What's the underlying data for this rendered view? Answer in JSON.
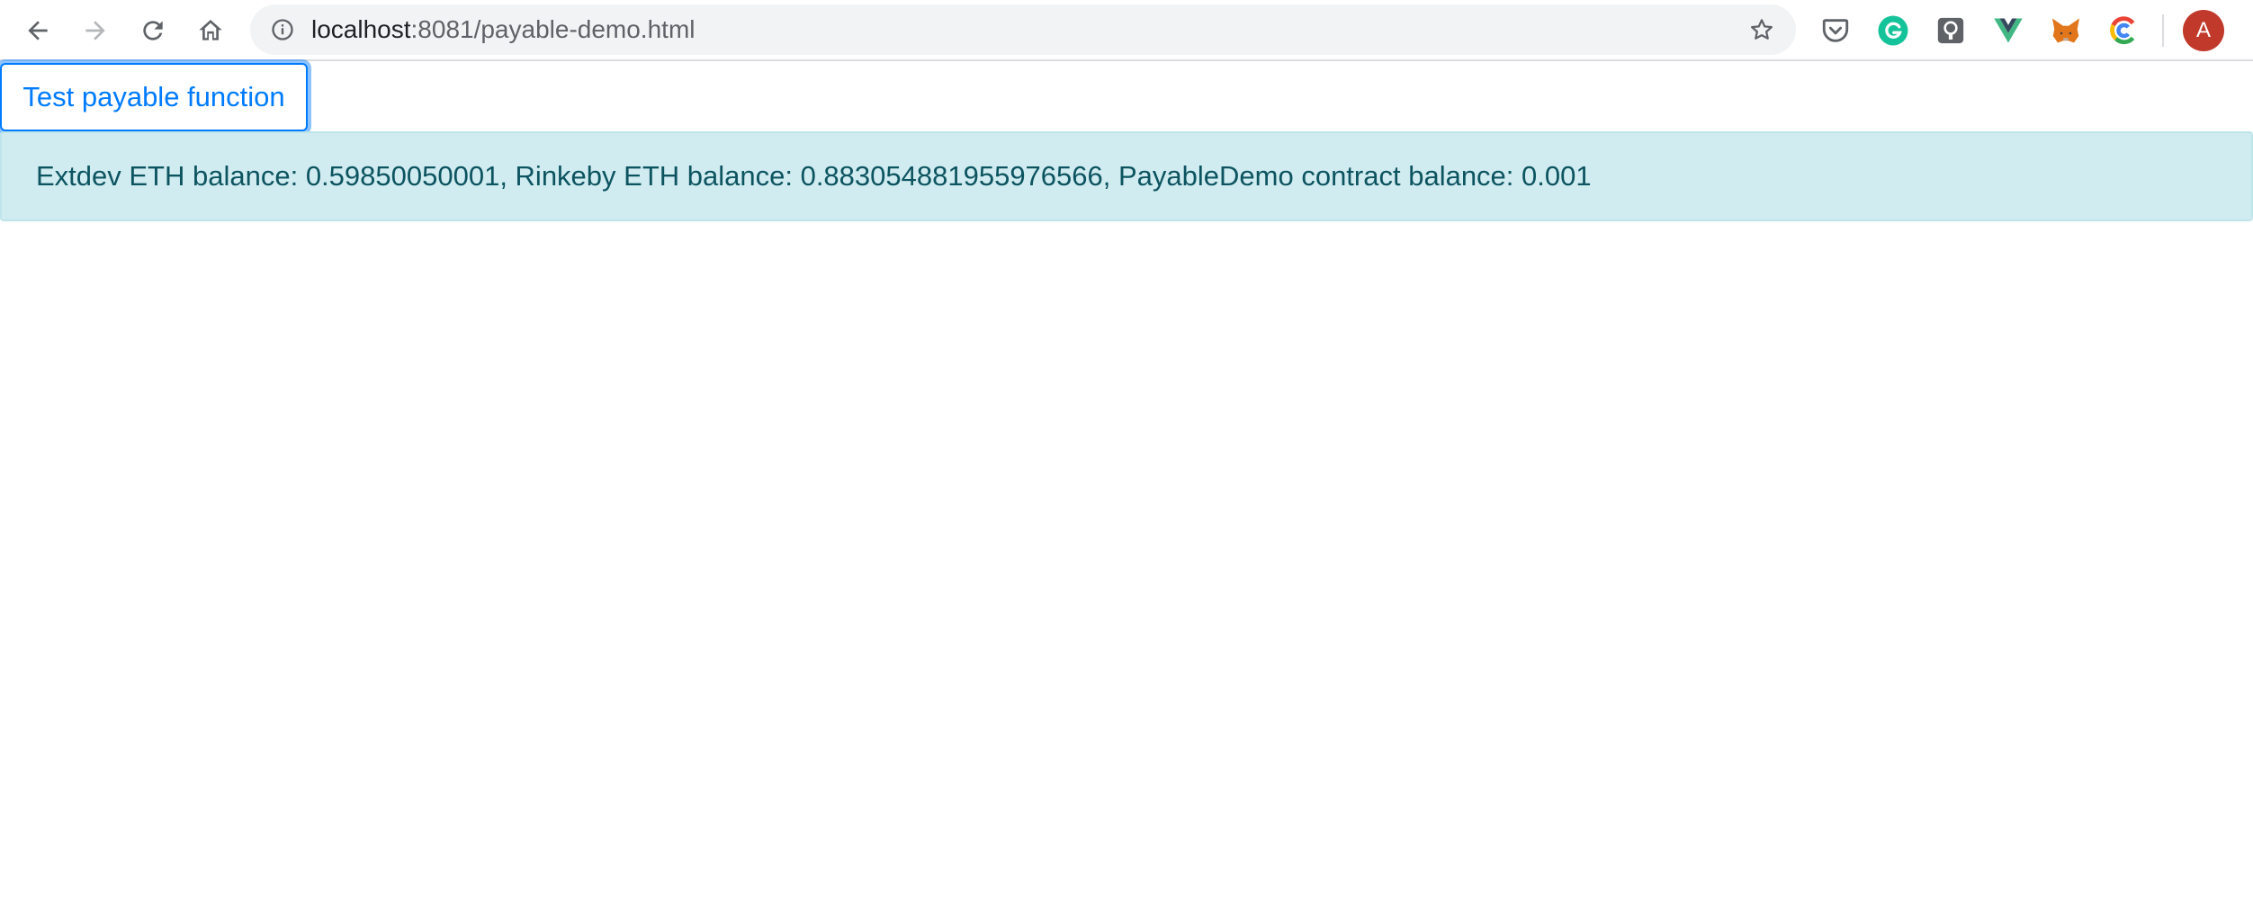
{
  "browser": {
    "url_host": "localhost",
    "url_path": ":8081/payable-demo.html",
    "profile_initial": "A",
    "icons": {
      "back": "back-arrow-icon",
      "forward": "forward-arrow-icon",
      "reload": "reload-icon",
      "home": "home-icon",
      "site_info": "info-icon",
      "bookmark": "star-icon"
    },
    "extensions": [
      "pocket-icon",
      "grammarly-icon",
      "lastpass-icon",
      "vue-devtools-icon",
      "metamask-icon",
      "chrome-color-icon"
    ]
  },
  "page": {
    "button_label": "Test payable function",
    "alert_text": "Extdev ETH balance: 0.59850050001, Rinkeby ETH balance: 0.883054881955976566, PayableDemo contract balance: 0.001"
  },
  "colors": {
    "primary": "#007bff",
    "alert_bg": "#d1ecf1",
    "alert_text": "#0c5460",
    "avatar_bg": "#c0392b"
  }
}
